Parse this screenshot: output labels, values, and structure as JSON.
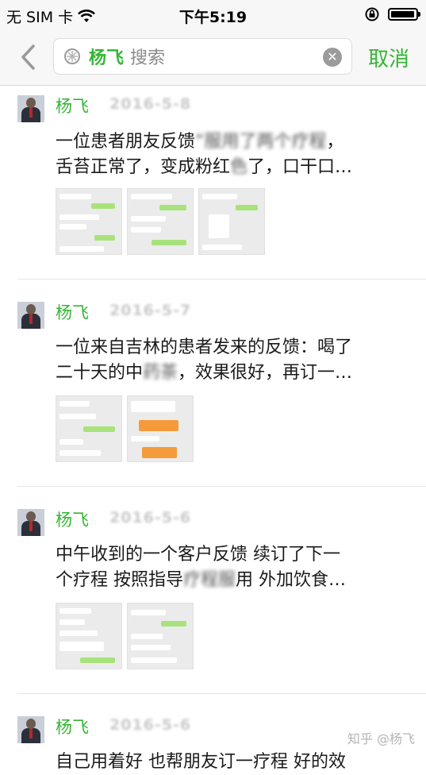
{
  "status_bar": {
    "carrier": "无 SIM 卡",
    "time": "下午5:19"
  },
  "search": {
    "query": "杨飞",
    "placeholder": "搜索",
    "cancel_label": "取消"
  },
  "results": [
    {
      "author": "杨飞",
      "date": "2016-5-8",
      "line1_a": "一位患者朋友反馈",
      "line1_blur": "“服用了两个疗程",
      "line1_b": "，",
      "line2_a": "舌苔正常了，变成粉红",
      "line2_blur": "色",
      "line2_b": "了，口干口…",
      "thumb_count": 3
    },
    {
      "author": "杨飞",
      "date": "2016-5-7",
      "line1_a": "一位来自吉林的患者发来的反馈：喝了",
      "line1_blur": "",
      "line1_b": "",
      "line2_a": "二十天的中",
      "line2_blur": "药茶",
      "line2_b": "，效果很好，再订一…",
      "thumb_count": 2
    },
    {
      "author": "杨飞",
      "date": "2016-5-6",
      "line1_a": "中午收到的一个客户反馈 续订了下一",
      "line1_blur": "",
      "line1_b": "",
      "line2_a": "个疗程 按照指导",
      "line2_blur": "疗程服",
      "line2_b": "用 外加饮食…",
      "thumb_count": 2
    },
    {
      "author": "杨飞",
      "date": "2016-5-6",
      "line1_a": "自己用着好 也帮朋友订一疗程 好的效",
      "line1_blur": "",
      "line1_b": "",
      "line2_a": "",
      "line2_blur": "",
      "line2_b": "",
      "thumb_count": 0
    }
  ],
  "watermark": "知乎 @杨飞",
  "colors": {
    "accent_green": "#35b535",
    "bar_bg": "#f7f7f7"
  },
  "icons": [
    "back-chevron-icon",
    "search-icon",
    "clear-icon",
    "wifi-icon",
    "orientation-lock-icon",
    "battery-icon"
  ]
}
